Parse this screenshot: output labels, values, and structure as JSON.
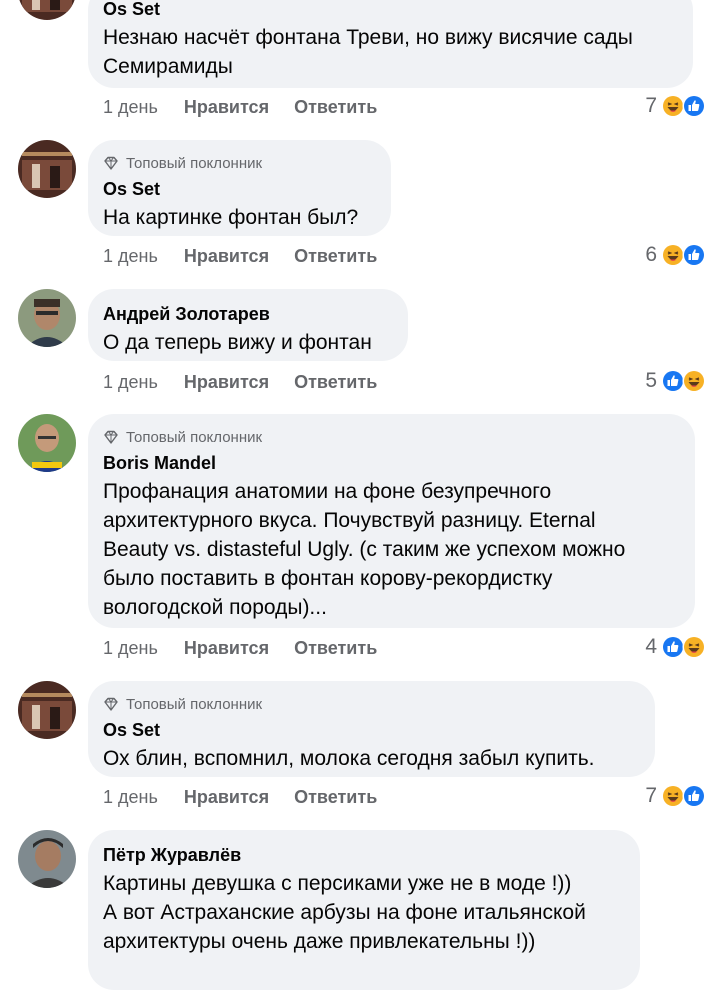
{
  "badge_label": "Топовый поклонник",
  "comments": [
    {
      "author": "Os Set",
      "badge": false,
      "lines": [
        "Незнаю насчёт фонтана Треви, но вижу висячие сады",
        "Семирамиды"
      ],
      "time": "1 день",
      "like": "Нравится",
      "reply": "Ответить",
      "reaction_count": "7",
      "reactions": [
        "haha-icon",
        "like-icon"
      ]
    },
    {
      "author": "Os Set",
      "badge": true,
      "lines": [
        "На картинке фонтан был?"
      ],
      "time": "1 день",
      "like": "Нравится",
      "reply": "Ответить",
      "reaction_count": "6",
      "reactions": [
        "haha-icon",
        "like-icon"
      ]
    },
    {
      "author": "Андрей Золотарев",
      "badge": false,
      "lines": [
        "О да теперь вижу и фонтан"
      ],
      "time": "1 день",
      "like": "Нравится",
      "reply": "Ответить",
      "reaction_count": "5",
      "reactions": [
        "like-icon",
        "haha-icon"
      ]
    },
    {
      "author": "Boris Mandel",
      "badge": true,
      "lines": [
        "Профанация анатомии на фоне безупречного",
        "архитектурного вкуса. Почувствуй разницу. Eternal",
        "Beauty vs. distasteful Ugly. (с таким же успехом можно",
        "было поставить в фонтан корову-рекордистку",
        "вологодской породы)..."
      ],
      "time": "1 день",
      "like": "Нравится",
      "reply": "Ответить",
      "reaction_count": "4",
      "reactions": [
        "like-icon",
        "haha-icon"
      ]
    },
    {
      "author": "Os Set",
      "badge": true,
      "lines": [
        "Ох блин, вспомнил, молока сегодня забыл купить."
      ],
      "time": "1 день",
      "like": "Нравится",
      "reply": "Ответить",
      "reaction_count": "7",
      "reactions": [
        "haha-icon",
        "like-icon"
      ]
    },
    {
      "author": "Пётр Журавлёв",
      "badge": false,
      "lines": [
        "Картины девушка с персиками уже не в моде !))",
        "А вот Астраханские арбузы на фоне итальянской",
        "архитектуры очень даже привлекательны !))"
      ]
    }
  ],
  "colors": {
    "bubble": "#f0f2f5",
    "meta_text": "#65676b",
    "like_blue": "#1877f2",
    "haha_yellow": "#f7b125"
  }
}
